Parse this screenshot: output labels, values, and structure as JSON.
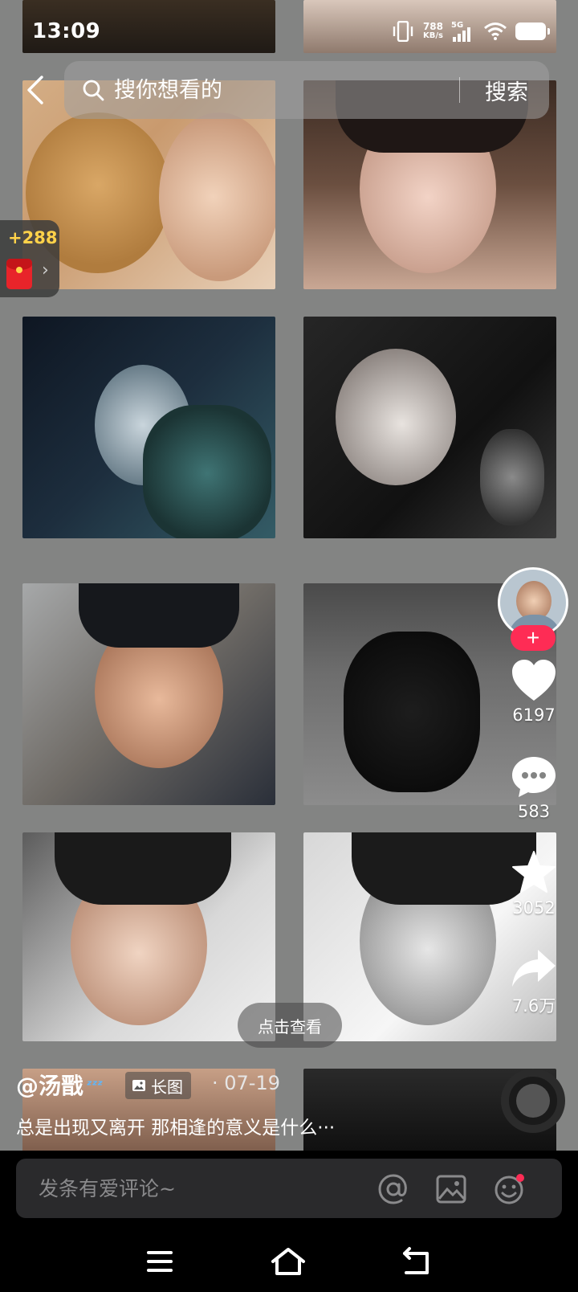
{
  "status_bar": {
    "time": "13:09",
    "net_speed_value": "788",
    "net_speed_unit": "KB/s",
    "network_type": "5G"
  },
  "search": {
    "placeholder": "搜你想看的",
    "button_label": "搜索"
  },
  "bonus": {
    "points": "+288"
  },
  "actions": {
    "follow_label": "+",
    "likes": "6197",
    "comments": "583",
    "favorites": "3052",
    "shares": "7.6万"
  },
  "view_pill_label": "点击查看",
  "post": {
    "author": "@汤戬",
    "badge_emoji": "ᶻᶻᶻ",
    "tag_label": "长图",
    "date": "· 07-19",
    "description": "总是出现又离开 那相逢的意义是什么···"
  },
  "comment_bar": {
    "placeholder": "发条有爱评论~"
  },
  "colors": {
    "board_gray": "#838483",
    "follow_red": "#fe2c55",
    "bonus_yellow": "#ffd24a",
    "envelope_red": "#e8242a"
  },
  "icons": [
    "back-icon",
    "search-icon",
    "red-envelope-icon",
    "heart-icon",
    "comment-icon",
    "star-icon",
    "share-icon",
    "at-icon",
    "image-icon",
    "emoji-icon",
    "menu-icon",
    "home-icon",
    "back-nav-icon",
    "music-disc-icon",
    "wifi-icon",
    "battery-icon",
    "vibrate-icon"
  ]
}
